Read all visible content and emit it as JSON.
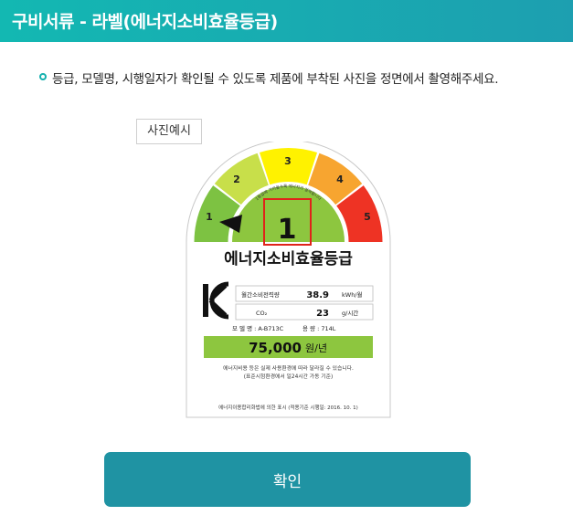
{
  "header": {
    "title": "구비서류 - 라벨(에너지소비효율등급)"
  },
  "instruction": "등급, 모델명, 시행일자가 확인될 수 있도록 제품에 부착된 사진을 정면에서 촬영해주세요.",
  "example_tag": "사진예시",
  "label": {
    "grades": [
      "1",
      "2",
      "3",
      "4",
      "5"
    ],
    "current_grade": "1",
    "arc_small_text": "1등급에 가까울수록 에너지가 절약됩니다",
    "title": "에너지소비효율등급",
    "kc_mark": "KC",
    "row1_label": "월간소비전력량",
    "row1_value": "38.9",
    "row1_unit": "kWh/월",
    "row2_label": "CO₂",
    "row2_value": "23",
    "row2_unit": "g/시간",
    "model_line": "모 델 명 : A-B713C",
    "capacity_line": "용   량 : 714L",
    "cost_value": "75,000",
    "cost_unit": "원/년",
    "note1": "에너지비용 등은 실제 사용환경에 따라 달라질 수 있습니다.",
    "note2": "(표준시험환경에서 일24시간 가동 기준)",
    "footer": "에너지이용합리화법에 의한 표시 (적용기준 시행일: 2016. 10. 1)"
  },
  "colors": {
    "header_start": "#13b8b2",
    "header_end": "#1d9fb0",
    "button": "#1f93a3",
    "grade1": "#7dc242",
    "grade2": "#c8df4a",
    "grade3": "#fff200",
    "grade4": "#f7a530",
    "grade5": "#ee3324"
  },
  "confirm_button": {
    "label": "확인"
  }
}
